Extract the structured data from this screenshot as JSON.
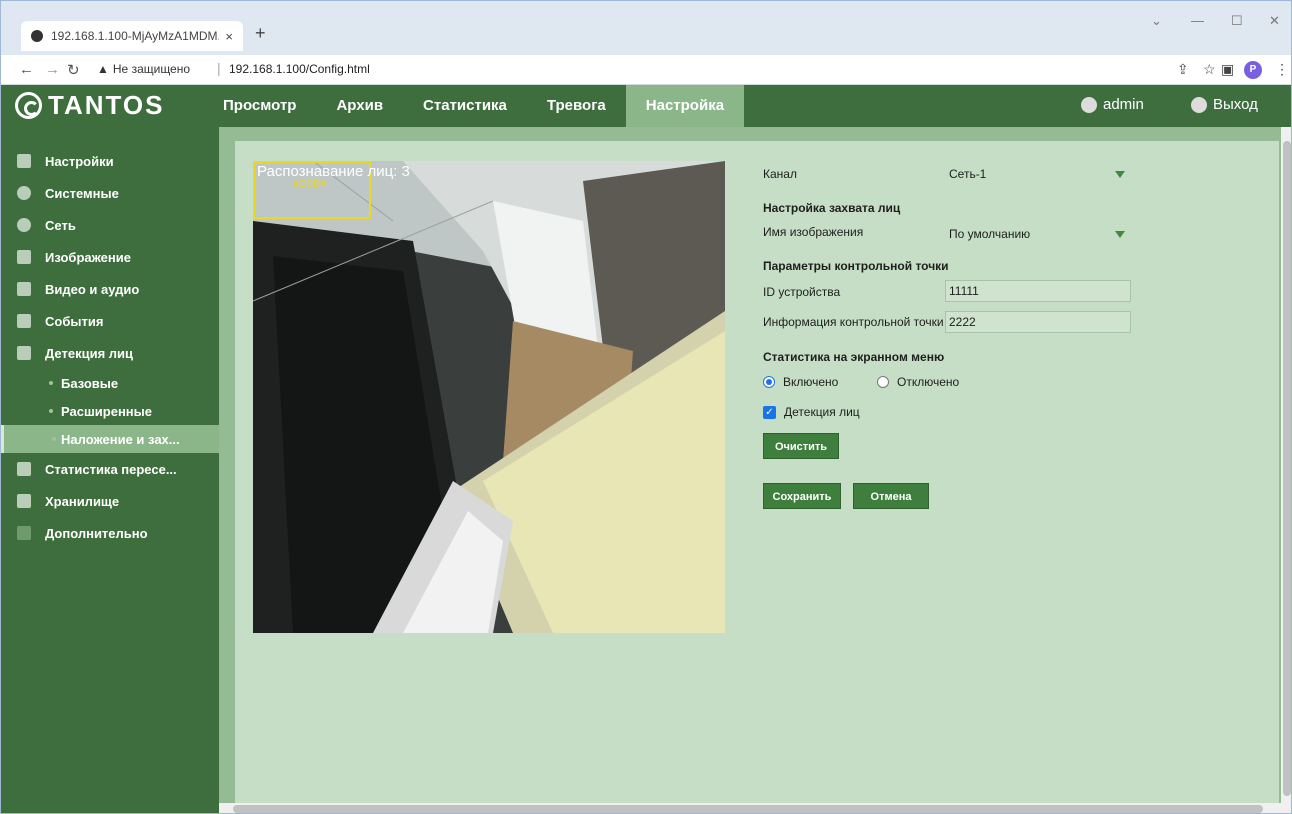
{
  "browser": {
    "tab_title": "192.168.1.100-MjAyMzA1MDM...",
    "tab_close": "×",
    "new_tab": "+",
    "security_label": "Не защищено",
    "url": "192.168.1.100/Config.html",
    "profile_initial": "P"
  },
  "app": {
    "logo": "TANTOS",
    "menu": [
      "Просмотр",
      "Архив",
      "Статистика",
      "Тревога",
      "Настройка"
    ],
    "active_menu": "Настройка",
    "user": "admin",
    "logout": "Выход"
  },
  "sidebar": {
    "items": [
      {
        "label": "Настройки",
        "icon": "list-icon"
      },
      {
        "label": "Системные",
        "icon": "info-icon"
      },
      {
        "label": "Сеть",
        "icon": "globe-icon"
      },
      {
        "label": "Изображение",
        "icon": "image-icon"
      },
      {
        "label": "Видео и аудио",
        "icon": "video-icon"
      },
      {
        "label": "События",
        "icon": "events-icon"
      },
      {
        "label": "Детекция лиц",
        "icon": "face-icon"
      }
    ],
    "subitems": [
      "Базовые",
      "Расширенные",
      "Наложение и зах..."
    ],
    "active_subitem": "Наложение и зах...",
    "items_after": [
      {
        "label": "Статистика пересе...",
        "icon": "bar-chart-icon"
      },
      {
        "label": "Хранилище",
        "icon": "storage-icon"
      },
      {
        "label": "Дополнительно",
        "icon": "advanced-icon"
      }
    ]
  },
  "video": {
    "osd_title": "Распознавание лиц: 3",
    "osd_sub": "#OSD#"
  },
  "form": {
    "channel_label": "Канал",
    "channel_value": "Сеть-1",
    "capture_title": "Настройка захвата лиц",
    "image_name_label": "Имя изображения",
    "image_name_value": "По умолчанию",
    "checkpoint_title": "Параметры контрольной точки",
    "device_id_label": "ID устройства",
    "device_id_value": "11111",
    "checkpoint_info_label": "Информация контрольной точки",
    "checkpoint_info_value": "2222",
    "osd_stats_title": "Статистика на экранном меню",
    "enabled_label": "Включено",
    "disabled_label": "Отключено",
    "osd_enabled": true,
    "face_detection_label": "Детекция лиц",
    "face_detection_checked": true,
    "clear_button": "Очистить",
    "save_button": "Сохранить",
    "cancel_button": "Отмена"
  },
  "colors": {
    "topbar": "#3f6e3e",
    "active_menu": "#8bb68a",
    "panel": "#c6dec5",
    "button": "#3f7f3e",
    "accent": "#1a73e8"
  }
}
